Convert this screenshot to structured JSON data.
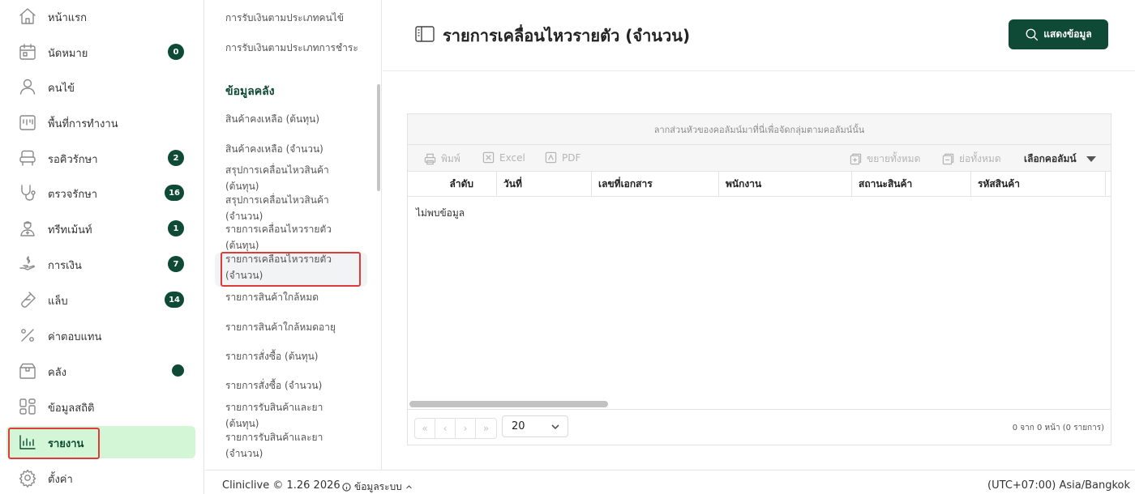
{
  "nav": {
    "items": [
      {
        "label": "หน้าแรก",
        "icon": "home-icon"
      },
      {
        "label": "นัดหมาย",
        "icon": "calendar-icon",
        "badge": "0"
      },
      {
        "label": "คนไข้",
        "icon": "user-icon"
      },
      {
        "label": "พื้นที่การทำงาน",
        "icon": "workspace-icon"
      },
      {
        "label": "รอคิวรักษา",
        "icon": "dental-chair-icon",
        "badge": "2"
      },
      {
        "label": "ตรวจรักษา",
        "icon": "stethoscope-icon",
        "badge": "16"
      },
      {
        "label": "ทรีทเม้นท์",
        "icon": "doctor-icon",
        "badge": "1"
      },
      {
        "label": "การเงิน",
        "icon": "payment-icon",
        "badge": "7"
      },
      {
        "label": "แล็บ",
        "icon": "test-tube-icon",
        "badge": "14"
      },
      {
        "label": "ค่าตอบแทน",
        "icon": "percent-icon"
      },
      {
        "label": "คลัง",
        "icon": "box-icon",
        "dot": true
      },
      {
        "label": "ข้อมูลสถิติ",
        "icon": "dashboard-icon"
      },
      {
        "label": "รายงาน",
        "icon": "report-icon",
        "active": true
      },
      {
        "label": "ตั้งค่า",
        "icon": "settings-icon"
      }
    ]
  },
  "submenu": {
    "items_top": [
      "การรับเงินตามประเภทคนไข้",
      "การรับเงินตามประเภทการชำระ"
    ],
    "heading": "ข้อมูลคลัง",
    "items": [
      "สินค้าคงเหลือ (ต้นทุน)",
      "สินค้าคงเหลือ (จำนวน)",
      "สรุปการเคลื่อนไหวสินค้า (ต้นทุน)",
      "สรุปการเคลื่อนไหวสินค้า (จำนวน)",
      "รายการเคลื่อนไหวรายตัว (ต้นทุน)",
      "รายการเคลื่อนไหวรายตัว (จำนวน)",
      "รายการสินค้าใกล้หมด",
      "รายการสินค้าใกล้หมดอายุ",
      "รายการสั่งซื้อ (ต้นทุน)",
      "รายการสั่งซื้อ (จำนวน)",
      "รายการรับสินค้าและยา (ต้นทุน)",
      "รายการรับสินค้าและยา (จำนวน)"
    ]
  },
  "page": {
    "title": "รายการเคลื่อนไหวรายตัว (จำนวน)",
    "show_button": "แสดงข้อมูล"
  },
  "grid": {
    "group_hint": "ลากส่วนหัวของคอลัมน์มาที่นี่เพื่อจัดกลุ่มตามคอลัมน์นั้น",
    "toolbar": {
      "print": "พิมพ์",
      "excel": "Excel",
      "pdf": "PDF",
      "expand_all": "ขยายทั้งหมด",
      "collapse_all": "ย่อทั้งหมด",
      "choose_columns": "เลือกคอลัมน์"
    },
    "columns": [
      "ลำดับ",
      "วันที่",
      "เลขที่เอกสาร",
      "พนักงาน",
      "สถานะสินค้า",
      "รหัสสินค้า"
    ],
    "empty_text": "ไม่พบข้อมูล",
    "pager": {
      "first": "«",
      "prev": "‹",
      "next": "›",
      "last": "»",
      "page_size": "20",
      "info": "0 จาก 0 หน้า (0 รายการ)"
    }
  },
  "footer": {
    "copyright": "Cliniclive © 1.26 2026",
    "system_info": "ข้อมูลระบบ",
    "timezone": "(UTC+07:00) Asia/Bangkok"
  },
  "colors": {
    "brand": "#0e4a36",
    "active_nav_bg": "#d3f7d6",
    "highlight": "#e03b3b"
  }
}
